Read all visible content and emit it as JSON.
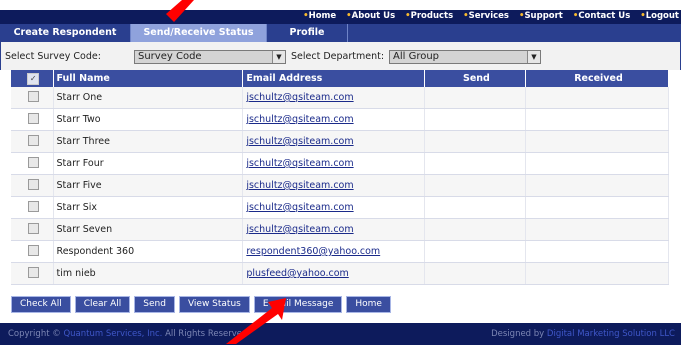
{
  "top_nav": [
    "Home",
    "About Us",
    "Products",
    "Services",
    "Support",
    "Contact Us",
    "Logout"
  ],
  "tabs": [
    "Create Respondent",
    "Send/Receive Status",
    "Profile"
  ],
  "filters": {
    "survey_code_label": "Select Survey Code:",
    "survey_code_value": "Survey Code",
    "department_label": "Select Department:",
    "department_value": "All Group"
  },
  "table": {
    "headers": [
      "Full Name",
      "Email Address",
      "Send",
      "Received"
    ],
    "rows": [
      {
        "name": "Starr One",
        "email": "jschultz@qsiteam.com"
      },
      {
        "name": "Starr Two",
        "email": "jschultz@qsiteam.com"
      },
      {
        "name": "Starr Three",
        "email": "jschultz@qsiteam.com"
      },
      {
        "name": "Starr Four",
        "email": "jschultz@qsiteam.com"
      },
      {
        "name": "Starr Five",
        "email": "jschultz@qsiteam.com"
      },
      {
        "name": "Starr Six",
        "email": "jschultz@qsiteam.com"
      },
      {
        "name": "Starr Seven",
        "email": "jschultz@qsiteam.com"
      },
      {
        "name": "Respondent 360",
        "email": "respondent360@yahoo.com"
      },
      {
        "name": "tim nieb",
        "email": "plusfeed@yahoo.com"
      }
    ]
  },
  "buttons": [
    "Check All",
    "Clear All",
    "Send",
    "View Status",
    "E-mail Message",
    "Home"
  ],
  "footer": {
    "copyright_prefix": "Copyright ©",
    "company": "Quantum Services, Inc.",
    "rights": "All Rights Reserved",
    "designed_by": "Designed by",
    "designer": "Digital Marketing Solution LLC"
  },
  "colors": {
    "nav_bg": "#0d1b5c",
    "tab_bg": "#2a3f8f",
    "active_tab": "#8fa2dc",
    "annotation_arrow": "#ff0000"
  }
}
